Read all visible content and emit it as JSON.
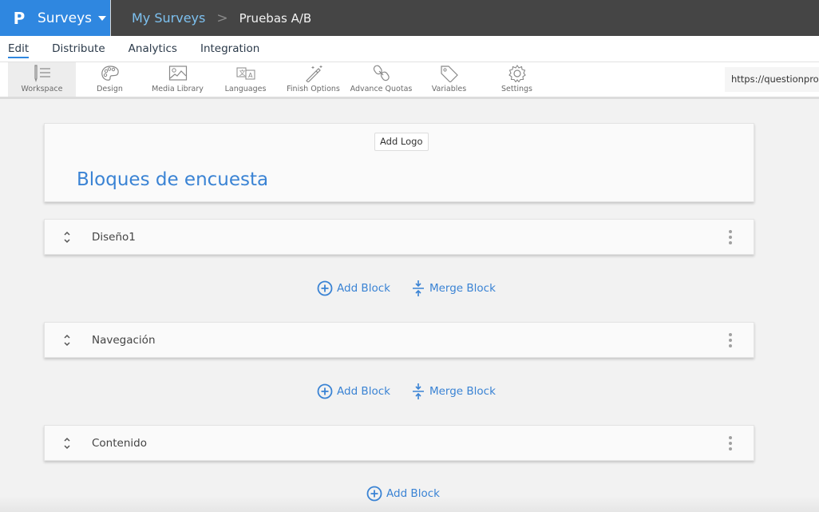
{
  "topbar": {
    "logo_glyph": "P",
    "product": "Surveys",
    "breadcrumb": {
      "parent": "My Surveys",
      "separator": ">",
      "current": "Pruebas A/B"
    },
    "colors": {
      "brand": "#2f87e0",
      "bar": "#454545",
      "link": "#7dc1f0"
    }
  },
  "nav": {
    "tabs": [
      {
        "label": "Edit",
        "active": true
      },
      {
        "label": "Distribute",
        "active": false
      },
      {
        "label": "Analytics",
        "active": false
      },
      {
        "label": "Integration",
        "active": false
      }
    ]
  },
  "toolbar": {
    "tools": [
      {
        "label": "Workspace",
        "icon": "workspace-icon",
        "active": true
      },
      {
        "label": "Design",
        "icon": "palette-icon"
      },
      {
        "label": "Media Library",
        "icon": "image-icon"
      },
      {
        "label": "Languages",
        "icon": "translate-icon"
      },
      {
        "label": "Finish Options",
        "icon": "magic-wand-icon"
      },
      {
        "label": "Advance Quotas",
        "icon": "link-chain-icon"
      },
      {
        "label": "Variables",
        "icon": "tag-icon"
      },
      {
        "label": "Settings",
        "icon": "gear-icon"
      }
    ],
    "url": "https://questionpro."
  },
  "survey": {
    "add_logo": "Add Logo",
    "title": "Bloques de encuesta",
    "blocks": [
      {
        "label": "Diseño1"
      },
      {
        "label": "Navegación"
      },
      {
        "label": "Contenido"
      }
    ],
    "add_block": "Add Block",
    "merge_block": "Merge Block",
    "accent": "#3a83d4"
  }
}
